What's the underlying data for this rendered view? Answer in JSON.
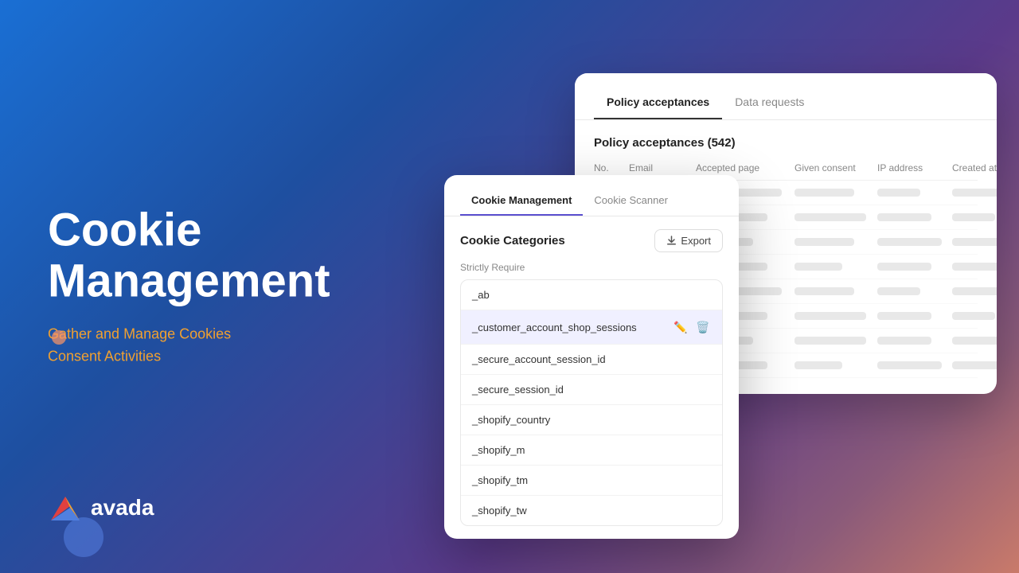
{
  "background": {
    "gradient_desc": "blue-purple-rose gradient"
  },
  "left": {
    "title_line1": "Cookie",
    "title_line2": "Management",
    "subtitle_line1": "Gather and Manage Cookies",
    "subtitle_line2": "Consent Activities",
    "logo_text": "avada"
  },
  "policy_window": {
    "tab_active": "Policy acceptances",
    "tab_inactive": "Data requests",
    "count_title": "Policy acceptances (542)",
    "columns": [
      "No.",
      "Email",
      "Accepted page",
      "Given consent",
      "IP address",
      "Created at"
    ],
    "rows_count": 8
  },
  "cookie_window": {
    "tab_active": "Cookie Management",
    "tab_inactive": "Cookie Scanner",
    "section_title": "Cookie Categories",
    "export_label": "Export",
    "strictly_require_label": "Strictly Require",
    "cookie_items": [
      {
        "name": "_ab",
        "highlighted": false
      },
      {
        "name": "_customer_account_shop_sessions",
        "highlighted": true
      },
      {
        "name": "_secure_account_session_id",
        "highlighted": false
      },
      {
        "name": "_secure_session_id",
        "highlighted": false
      },
      {
        "name": "_shopify_country",
        "highlighted": false
      },
      {
        "name": "_shopify_m",
        "highlighted": false
      },
      {
        "name": "_shopify_tm",
        "highlighted": false
      },
      {
        "name": "_shopify_tw",
        "highlighted": false
      }
    ]
  }
}
